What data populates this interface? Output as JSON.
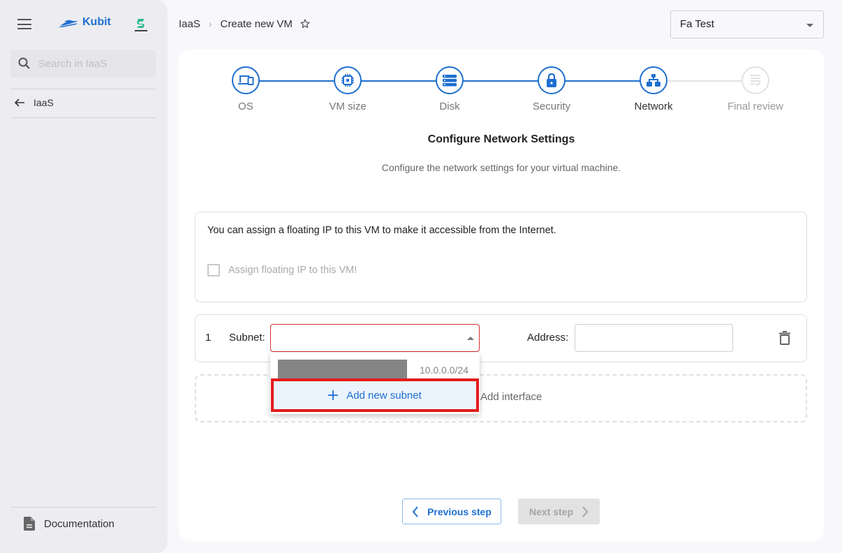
{
  "sidebar": {
    "brand": "Kubit",
    "search_placeholder": "Search in IaaS",
    "back_label": "IaaS",
    "documentation_label": "Documentation"
  },
  "header": {
    "breadcrumb": [
      "IaaS",
      "Create new VM"
    ],
    "organization": "Fa Test"
  },
  "stepper": {
    "steps": [
      {
        "label": "OS",
        "icon": "devices-icon",
        "state": "completed"
      },
      {
        "label": "VM size",
        "icon": "cpu-icon",
        "state": "completed"
      },
      {
        "label": "Disk",
        "icon": "storage-icon",
        "state": "completed"
      },
      {
        "label": "Security",
        "icon": "lock-icon",
        "state": "completed"
      },
      {
        "label": "Network",
        "icon": "network-icon",
        "state": "active"
      },
      {
        "label": "Final review",
        "icon": "review-icon",
        "state": "disabled"
      }
    ]
  },
  "section": {
    "title": "Configure Network Settings",
    "subtitle": "Configure the network settings for your virtual machine."
  },
  "floating_ip": {
    "info": "You can assign a floating IP to this VM to make it accessible from the Internet.",
    "checkbox_label": "Assign floating IP to this VM!",
    "checked": false
  },
  "interfaces": [
    {
      "index": "1",
      "subnet_label": "Subnet:",
      "subnet_value": "",
      "address_label": "Address:",
      "address_value": ""
    }
  ],
  "subnet_dropdown": {
    "options": [
      {
        "name": "[redacted]",
        "cidr": "10.0.0.0/24"
      }
    ],
    "add_label": "Add new subnet"
  },
  "add_interface_label": "Add interface",
  "buttons": {
    "previous": "Previous step",
    "next": "Next step"
  },
  "colors": {
    "accent": "#1e6fd0",
    "error": "#d32f2f",
    "highlight": "#e31b1b"
  }
}
